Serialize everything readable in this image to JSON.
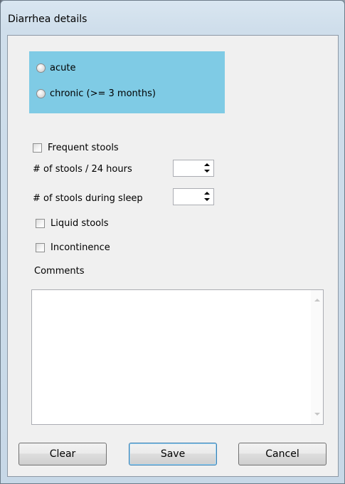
{
  "window": {
    "title": "Diarrhea details"
  },
  "onset": {
    "options": [
      {
        "label": "acute",
        "selected": false
      },
      {
        "label": "chronic (>= 3 months)",
        "selected": false
      }
    ],
    "panel_color": "#7fcbe5"
  },
  "frequent_stools": {
    "label": "Frequent stools",
    "checked": false
  },
  "stools_per_24h": {
    "label": "# of stools / 24 hours",
    "value": ""
  },
  "stools_during_sleep": {
    "label": "# of stools during sleep",
    "value": ""
  },
  "liquid_stools": {
    "label": "Liquid stools",
    "checked": false
  },
  "incontinence": {
    "label": "Incontinence",
    "checked": false
  },
  "comments": {
    "label": "Comments",
    "value": ""
  },
  "buttons": {
    "clear": "Clear",
    "save": "Save",
    "cancel": "Cancel"
  }
}
